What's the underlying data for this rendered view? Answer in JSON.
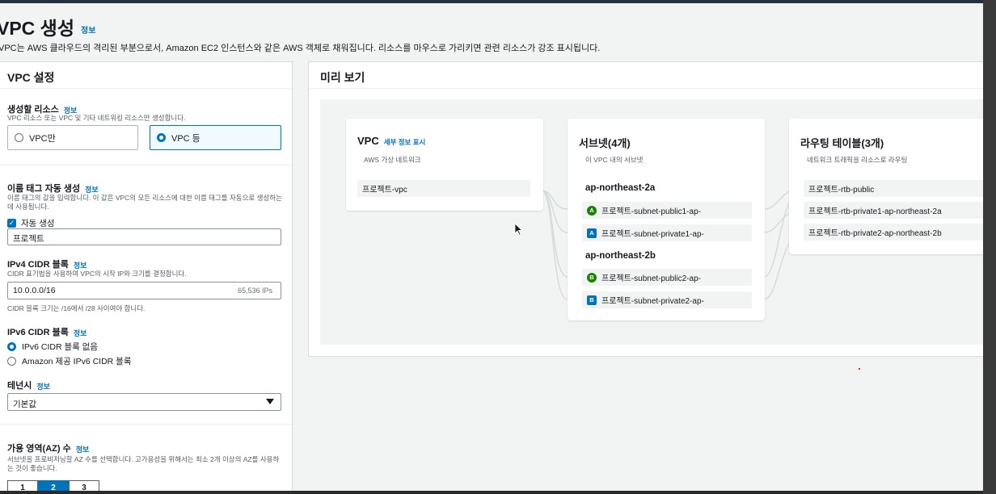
{
  "page": {
    "title": "VPC 생성",
    "title_info": "정보",
    "description": "VPC는 AWS 클라우드의 격리된 부분으로서, Amazon EC2 인스턴스와 같은 AWS 객체로 채워집니다. 리소스를 마우스로 가리키면 관련 리소스가 강조 표시됩니다."
  },
  "settings": {
    "heading": "VPC 설정",
    "resources": {
      "label": "생성할 리소스",
      "info": "정보",
      "hint": "VPC 리소스 또는 VPC 및 기타 네트워킹 리소스만 생성합니다.",
      "option_vpc_only": "VPC만",
      "option_vpc_more": "VPC 등",
      "selected": "VPC 등"
    },
    "name_tag": {
      "label": "이름 태그 자동 생성",
      "info": "정보",
      "hint": "이름 태그의 값을 입력합니다. 이 값은 VPC의 모든 리소스에 대한 이름 태그를 자동으로 생성하는 데 사용됩니다.",
      "auto_generate_label": "자동 생성",
      "auto_generate_checked": true,
      "value": "프로젝트"
    },
    "ipv4": {
      "label": "IPv4 CIDR 블록",
      "info": "정보",
      "hint": "CIDR 표기법을 사용하여 VPC의 시작 IP와 크기를 결정합니다.",
      "value": "10.0.0.0/16",
      "suffix": "65,536 IPs",
      "footnote": "CIDR 블록 크기는 /16에서 /28 사이여야 합니다."
    },
    "ipv6": {
      "label": "IPv6 CIDR 블록",
      "info": "정보",
      "option_none": "IPv6 CIDR 블록 없음",
      "option_amazon": "Amazon 제공 IPv6 CIDR 블록",
      "selected": "IPv6 CIDR 블록 없음"
    },
    "tenancy": {
      "label": "테넌시",
      "info": "정보",
      "value": "기본값"
    },
    "az": {
      "label": "가용 영역(AZ) 수",
      "info": "정보",
      "hint": "서브넷을 프로비저닝할 AZ 수를 선택합니다. 고가용성을 위해서는 최소 2개 이상의 AZ를 사용하는 것이 좋습니다.",
      "options": [
        "1",
        "2",
        "3"
      ],
      "selected": "2"
    }
  },
  "preview": {
    "heading": "미리 보기",
    "vpc": {
      "title": "VPC",
      "link": "세부 정보 표시",
      "subtitle": "AWS 가상 네트워크",
      "item": "프로젝트-vpc"
    },
    "subnets": {
      "title": "서브넷(4개)",
      "subtitle": "이 VPC 내의 서브넷",
      "zones": [
        {
          "name": "ap-northeast-2a",
          "items": [
            {
              "badge": "A",
              "kind": "public",
              "label": "프로젝트-subnet-public1-ap-"
            },
            {
              "badge": "A",
              "kind": "private",
              "label": "프로젝트-subnet-private1-ap-"
            }
          ]
        },
        {
          "name": "ap-northeast-2b",
          "items": [
            {
              "badge": "B",
              "kind": "public",
              "label": "프로젝트-subnet-public2-ap-"
            },
            {
              "badge": "B",
              "kind": "private",
              "label": "프로젝트-subnet-private2-ap-"
            }
          ]
        }
      ]
    },
    "route_tables": {
      "title": "라우팅 테이블(3개)",
      "subtitle": "네트워크 트래픽을 리소스로 라우팅",
      "items": [
        "프로젝트-rtb-public",
        "프로젝트-rtb-private1-ap-northeast-2a",
        "프로젝트-rtb-private2-ap-northeast-2b"
      ]
    }
  },
  "colors": {
    "accent": "#0073bb",
    "public_badge": "#1d8102",
    "private_badge": "#0073bb"
  }
}
